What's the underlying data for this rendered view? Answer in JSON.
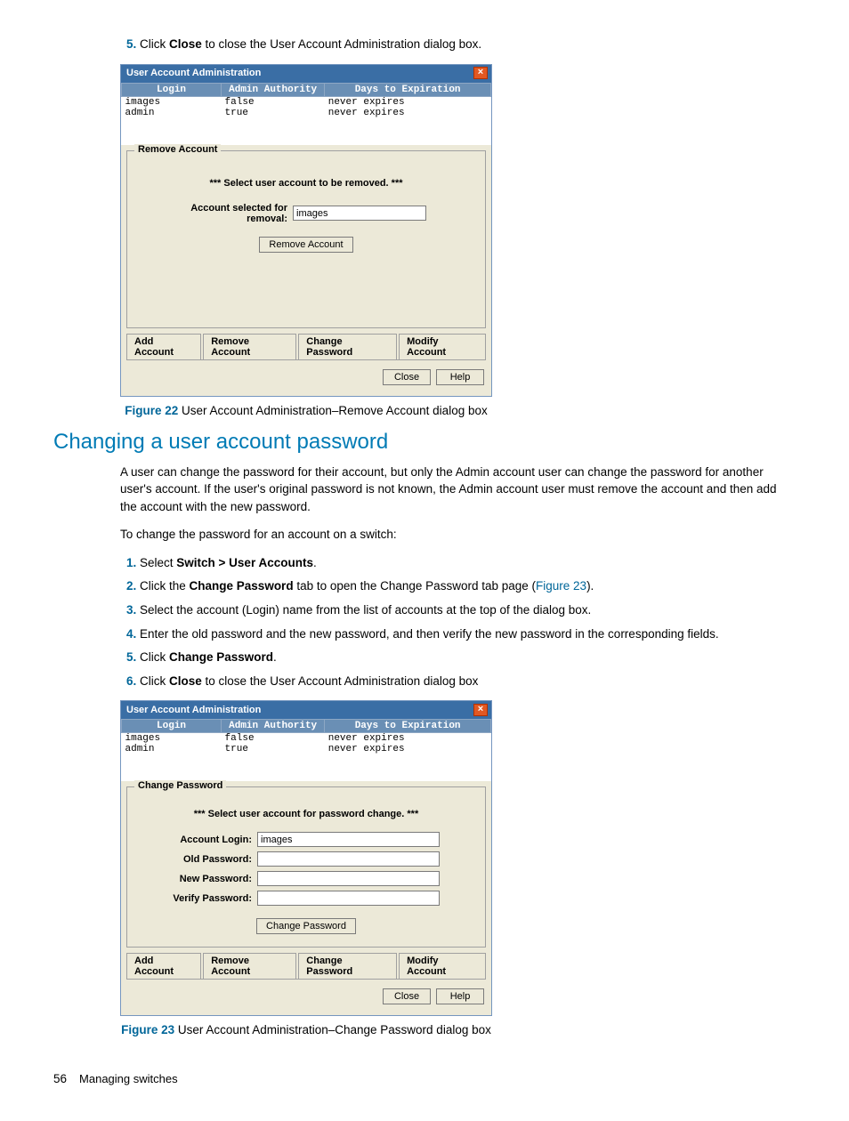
{
  "step5_top": {
    "num": "5.",
    "pre": "Click ",
    "bold": "Close",
    "post": " to close the User Account Administration dialog box."
  },
  "dlg1": {
    "title": "User Account Administration",
    "cols": [
      "Login",
      "Admin Authority",
      "Days to Expiration"
    ],
    "rows": [
      {
        "login": "images",
        "admin": "false",
        "exp": "never expires"
      },
      {
        "login": "admin",
        "admin": "true",
        "exp": "never expires"
      }
    ],
    "group_title": "Remove Account",
    "msg": "*** Select user account to be removed. ***",
    "field_label": "Account selected for removal:",
    "field_value": "images",
    "action_btn": "Remove Account",
    "tabs": [
      "Add Account",
      "Remove Account",
      "Change Password",
      "Modify Account"
    ],
    "close": "Close",
    "help": "Help"
  },
  "fig22": {
    "num": "Figure 22",
    "caption": " User Account Administration–Remove Account dialog box"
  },
  "section_heading": "Changing a user account password",
  "para1": "A user can change the password for their account, but only the Admin account user can change the password for another user's account. If the user's original password is not known, the Admin account user must remove the account and then add the account with the new password.",
  "para2": "To change the password for an account on a switch:",
  "steps": {
    "s1": {
      "pre": "Select ",
      "bold": "Switch > User Accounts",
      "post": "."
    },
    "s2": {
      "pre": "Click the ",
      "bold": "Change Password",
      "mid": " tab to open the Change Password tab page (",
      "link": "Figure 23",
      "post": ")."
    },
    "s3": "Select the account (Login) name from the list of accounts at the top of the dialog box.",
    "s4": "Enter the old password and the new password, and then verify the new password in the corresponding fields.",
    "s5": {
      "pre": "Click ",
      "bold": "Change Password",
      "post": "."
    },
    "s6": {
      "pre": "Click ",
      "bold": "Close",
      "post": " to close the User Account Administration dialog box"
    }
  },
  "dlg2": {
    "title": "User Account Administration",
    "cols": [
      "Login",
      "Admin Authority",
      "Days to Expiration"
    ],
    "rows": [
      {
        "login": "images",
        "admin": "false",
        "exp": "never expires"
      },
      {
        "login": "admin",
        "admin": "true",
        "exp": "never expires"
      }
    ],
    "group_title": "Change Password",
    "msg": "*** Select user account for password change. ***",
    "fields": {
      "login_label": "Account Login:",
      "login_value": "images",
      "old_label": "Old Password:",
      "new_label": "New Password:",
      "verify_label": "Verify Password:"
    },
    "action_btn": "Change Password",
    "tabs": [
      "Add Account",
      "Remove Account",
      "Change Password",
      "Modify Account"
    ],
    "close": "Close",
    "help": "Help"
  },
  "fig23": {
    "num": "Figure 23",
    "caption": " User Account Administration–Change Password dialog box"
  },
  "footer": {
    "page": "56",
    "section": "Managing switches"
  }
}
